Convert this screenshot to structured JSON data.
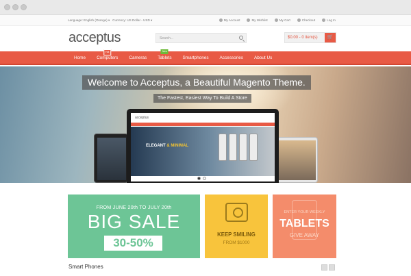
{
  "topbar": {
    "language": "Language: English (Orange)",
    "currency": "Currency: US Dollar - USD",
    "links": [
      "My Account",
      "My Wishlist",
      "My Cart",
      "Checkout",
      "Log In"
    ]
  },
  "header": {
    "logo": "acceptus",
    "search_placeholder": "Search...",
    "cart_text": "$0.00 - 0 item(s)"
  },
  "nav": {
    "items": [
      {
        "label": "Home"
      },
      {
        "label": "Computers",
        "badge": "Hot",
        "badge_color": "#e85a45"
      },
      {
        "label": "Cameras"
      },
      {
        "label": "Tablets",
        "badge": "New",
        "badge_color": "#6dbb3a"
      },
      {
        "label": "Smartphones"
      },
      {
        "label": "Accessories"
      },
      {
        "label": "About Us"
      }
    ]
  },
  "hero": {
    "title": "Welcome to Acceptus, a Beautiful Magento Theme.",
    "subtitle": "The Fastest, Easiest Way To Build A Store",
    "screen_logo": "acceptus",
    "screen_text_a": "ELEGANT",
    "screen_text_b": " & MINIMAL"
  },
  "promos": {
    "big_sale": {
      "dates": "FROM JUNE 20th TO JULY 20th",
      "title": "BIG SALE",
      "discount": "30-50%"
    },
    "keep_smiling": {
      "title": "KEEP SMILING",
      "price": "FROM $1000"
    },
    "tablets": {
      "top": "ENTER YOUR WEEKLY",
      "title": "TABLETS",
      "bottom": "GIVE AWAY"
    }
  },
  "section_title": "Smart Phones",
  "colors": {
    "accent": "#e85a45",
    "green": "#6dc596",
    "yellow": "#f8c43c",
    "salmon": "#f48c6b"
  }
}
